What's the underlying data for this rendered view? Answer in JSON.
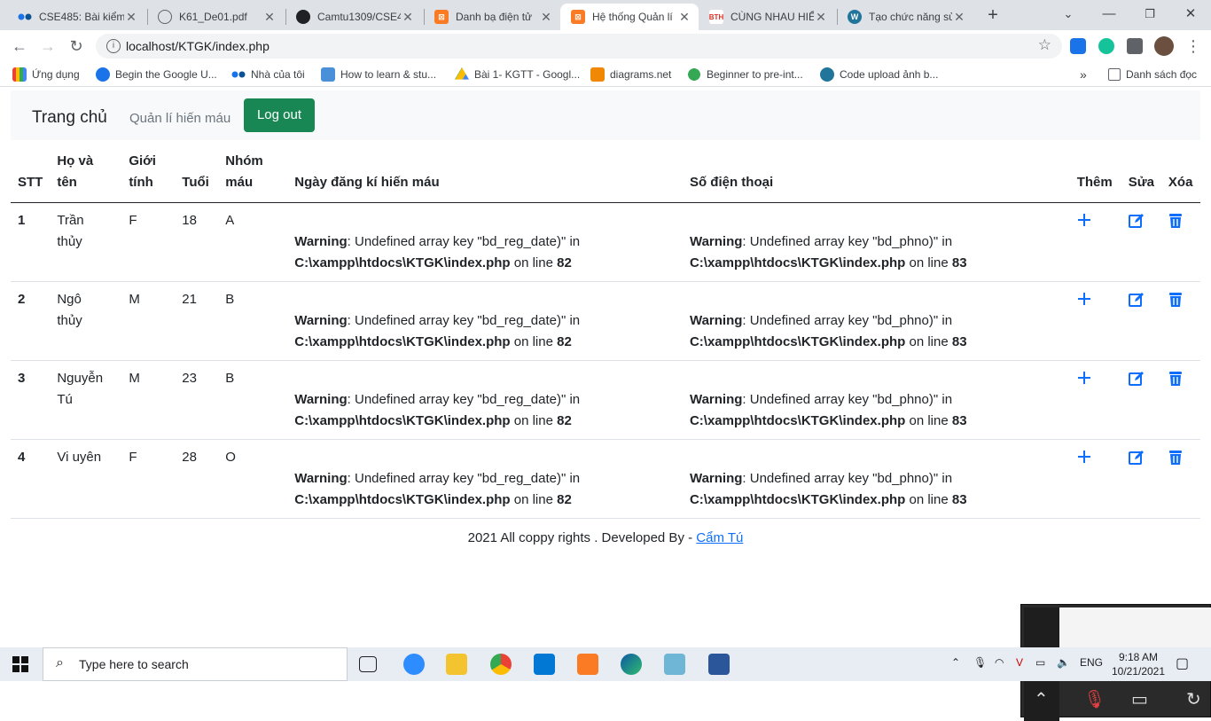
{
  "browser": {
    "tabs": [
      {
        "title": "CSE485: Bài kiểm",
        "icon": "dots-icon",
        "color": "#1a73e8"
      },
      {
        "title": "K61_De01.pdf",
        "icon": "globe-icon",
        "color": "#5f6368"
      },
      {
        "title": "Camtu1309/CSE4",
        "icon": "github-icon",
        "color": "#202124"
      },
      {
        "title": "Danh bạ điện tử",
        "icon": "xampp-icon",
        "color": "#fb7a24"
      },
      {
        "title": "Hệ thống Quản lí",
        "icon": "xampp-icon",
        "color": "#fb7a24",
        "active": true
      },
      {
        "title": "CÙNG NHAU HIỂ",
        "icon": "bth-icon",
        "color": "#d93025"
      },
      {
        "title": "Tạo chức năng sửa",
        "icon": "wordpress-icon",
        "color": "#21759b"
      }
    ],
    "url": "localhost/KTGK/index.php",
    "bookmarks": [
      {
        "label": "Ứng dụng",
        "icon": "apps-grid-icon"
      },
      {
        "label": "Begin the Google U...",
        "icon": "google-c-icon"
      },
      {
        "label": "Nhà của tôi",
        "icon": "dots-icon"
      },
      {
        "label": "How to learn & stu...",
        "icon": "ev-icon"
      },
      {
        "label": "Bài 1- KGTT - Googl...",
        "icon": "drive-icon"
      },
      {
        "label": "diagrams.net",
        "icon": "diagrams-icon"
      },
      {
        "label": "Beginner to pre-int...",
        "icon": "clover-icon"
      },
      {
        "label": "Code upload ảnh b...",
        "icon": "wordpress-icon"
      }
    ],
    "reading_list": "Danh sách đọc"
  },
  "page": {
    "navbar": {
      "brand": "Trang chủ",
      "link": "Quản lí hiến máu",
      "logout": "Log out"
    },
    "table": {
      "headers": {
        "stt": "STT",
        "name_l1": "Họ và",
        "name_l2": "tên",
        "gender_l1": "Giới",
        "gender_l2": "tính",
        "age": "Tuổi",
        "blood_l1": "Nhóm",
        "blood_l2": "máu",
        "reg_date": "Ngày đăng kí hiến máu",
        "phone": "Số điện thoại",
        "add": "Thêm",
        "edit": "Sửa",
        "delete": "Xóa"
      },
      "warning": {
        "label": "Warning",
        "date_msg": ": Undefined array key \"bd_reg_date)\" in",
        "phone_msg": ": Undefined array key \"bd_phno)\" in",
        "path": "C:\\xampp\\htdocs\\KTGK\\index.php",
        "on_line": " on line ",
        "date_line": "82",
        "phone_line": "83"
      },
      "rows": [
        {
          "stt": "1",
          "name_l1": "Trần",
          "name_l2": "thủy",
          "gender": "F",
          "age": "18",
          "blood": "A"
        },
        {
          "stt": "2",
          "name_l1": "Ngô",
          "name_l2": "thủy",
          "gender": "M",
          "age": "21",
          "blood": "B"
        },
        {
          "stt": "3",
          "name_l1": "Nguyễn",
          "name_l2": "Tú",
          "gender": "M",
          "age": "23",
          "blood": "B"
        },
        {
          "stt": "4",
          "name_l1": "Vi uyên",
          "name_l2": "",
          "gender": "F",
          "age": "28",
          "blood": "O"
        }
      ]
    },
    "footer": {
      "text": "2021 All coppy rights . Developed By - ",
      "author": "Cẩm Tú"
    }
  },
  "taskbar": {
    "search_placeholder": "Type here to search",
    "lang": "ENG",
    "time": "9:18 AM",
    "date": "10/21/2021"
  },
  "colors": {
    "primary": "#0d6efd",
    "success": "#198754",
    "danger": "#0d6efd"
  }
}
